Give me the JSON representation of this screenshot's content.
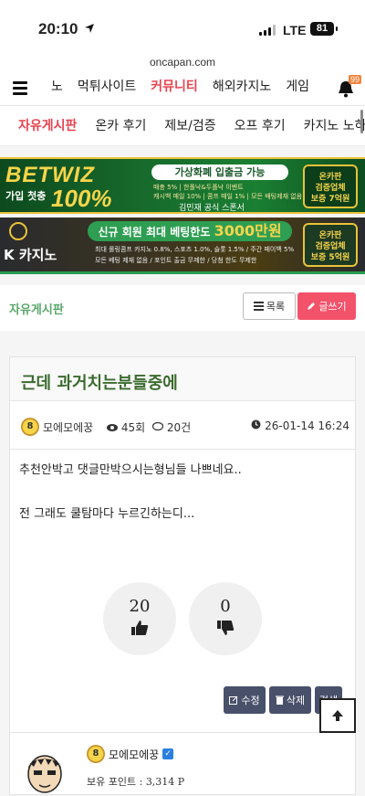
{
  "status": {
    "time": "20:10",
    "network": "LTE",
    "battery": "81"
  },
  "url": "oncapan.com",
  "nav_main": {
    "items": [
      "노",
      "먹튀사이트",
      "커뮤니티",
      "해외카지노",
      "게임"
    ],
    "active": "커뮤니티",
    "notification_count": "99"
  },
  "nav_sub": {
    "items": [
      "자유게시판",
      "온카 후기",
      "제보/검증",
      "오프 후기",
      "카지노 노하우"
    ],
    "active": "자유게시판"
  },
  "banner1": {
    "brand": "BETWIZ",
    "sub": "가입 첫충",
    "big": "100%",
    "headline": "가상화폐 입출금 가능",
    "lines": [
      "매충 5% | 한폴낙&두폴낙 이벤트",
      "캐시백 매일 10% | 콤프 매일 1% | 모든 배팅제재 없음"
    ],
    "sponsor": "김민재 공식 스폰서",
    "seal": [
      "온카판",
      "검증업체",
      "보증 7억원"
    ]
  },
  "banner2": {
    "brand": "K 카지노",
    "headline_prefix": "신규 회원 최대 베팅한도",
    "headline_big": "3000만원",
    "lines": [
      "최대 롤링콤프 카지노 0.8%, 스포츠 1.0%, 슬롯 1.5% / 주간 페이백 5%",
      "모든 베팅 제재 없음 / 포인트 출금 무제한 / 당첨 한도 무제한"
    ],
    "seal": [
      "온카판",
      "검증업체",
      "보증 5억원"
    ]
  },
  "board": {
    "title": "자유게시판",
    "list_label": "목록",
    "write_label": "글쓰기"
  },
  "post": {
    "title": "근데 과거치는분들중에",
    "author": "모에모에꿍",
    "level": "8",
    "views": "45회",
    "comments": "20건",
    "date": "26-01-14 16:24",
    "body": [
      "추천안박고 댓글만박으시는형님들 나쁘네요..",
      "전 그래도 쿨탐마다 누르긴하는디..."
    ],
    "upvotes": "20",
    "downvotes": "0",
    "edit_label": "수정",
    "delete_label": "삭제",
    "more_label": "검색"
  },
  "author_box": {
    "name": "모에모에꿍",
    "level": "8",
    "points_label": "보유 포인트 :",
    "points": "3,314 P"
  },
  "icons": [
    "location-arrow-icon",
    "hamburger-icon",
    "bell-icon",
    "list-icon",
    "pencil-icon",
    "user-icon",
    "eye-icon",
    "comment-icon",
    "clock-icon",
    "thumbs-up-icon",
    "thumbs-down-icon",
    "edit-icon",
    "trash-icon",
    "verified-icon",
    "arrow-up-icon"
  ],
  "colors": {
    "accent_red": "#e8434f",
    "board_green": "#5aa86a",
    "title_green": "#3b6b2e",
    "write_button": "#f2536a",
    "dark_button": "#48506a"
  }
}
